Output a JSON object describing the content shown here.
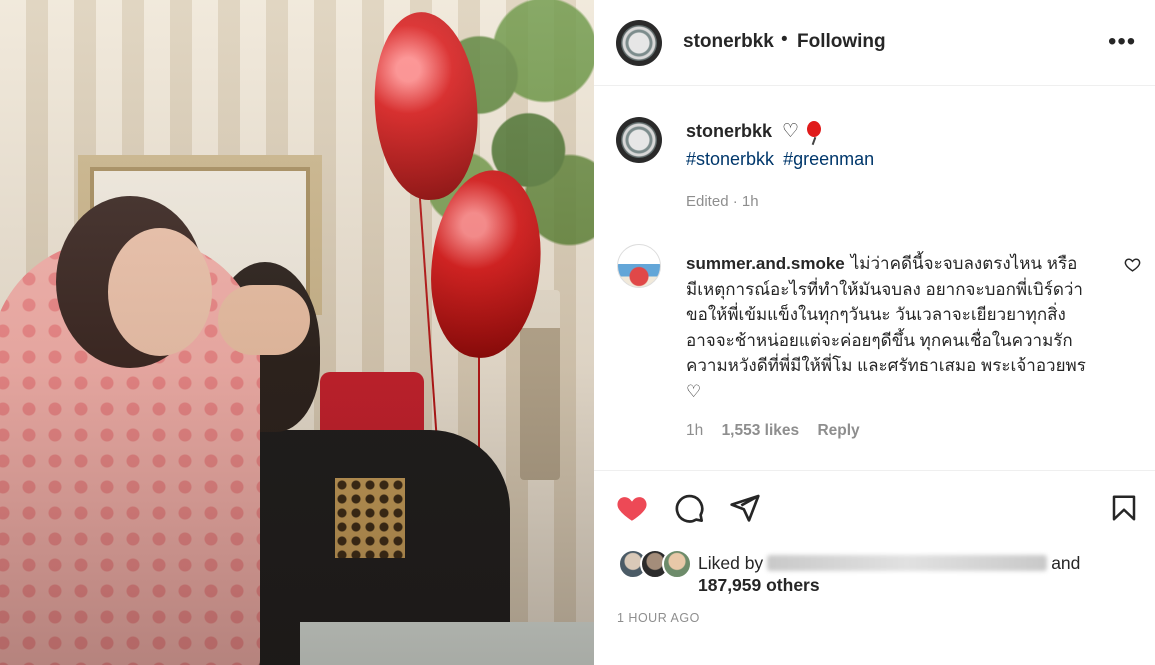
{
  "post": {
    "image_alt": "Photo of a couple seated in front of a striped wall with red heart balloons"
  },
  "header": {
    "username": "stonerbkk",
    "separator": "•",
    "follow_state": "Following",
    "more_label": "•••",
    "avatar_icon": "profile-logo-icon"
  },
  "caption": {
    "username": "stonerbkk",
    "emoji": "♡",
    "hashtags": [
      "#stonerbkk",
      "#greenman"
    ],
    "edited": "Edited · 1h"
  },
  "comment": {
    "username": "summer.and.smoke",
    "text": "ไม่ว่าคดีนี้จะจบลงตรงไหน หรือมีเหตุการณ์อะไรที่ทำให้มันจบลง อยากจะบอกพี่เบิร์ดว่า ขอให้พี่เข้มแข็งในทุกๆวันนะ วันเวลาจะเยียวยาทุกสิ่ง อาจจะช้าหน่อยแต่จะค่อยๆดีขึ้น ทุกคนเชื่อในความรัก ความหวังดีที่พี่มีให้พี่โม และศรัทธาเสมอ พระเจ้าอวยพร ♡",
    "time": "1h",
    "likes": "1,553 likes",
    "reply": "Reply"
  },
  "actions": {
    "like_icon": "heart-filled-icon",
    "comment_icon": "comment-icon",
    "share_icon": "share-icon",
    "save_icon": "bookmark-icon",
    "like_color": "#ed4956"
  },
  "likes": {
    "prefix": "Liked by",
    "suffix": "and",
    "count": "187,959 others"
  },
  "timestamp": "1 HOUR AGO"
}
